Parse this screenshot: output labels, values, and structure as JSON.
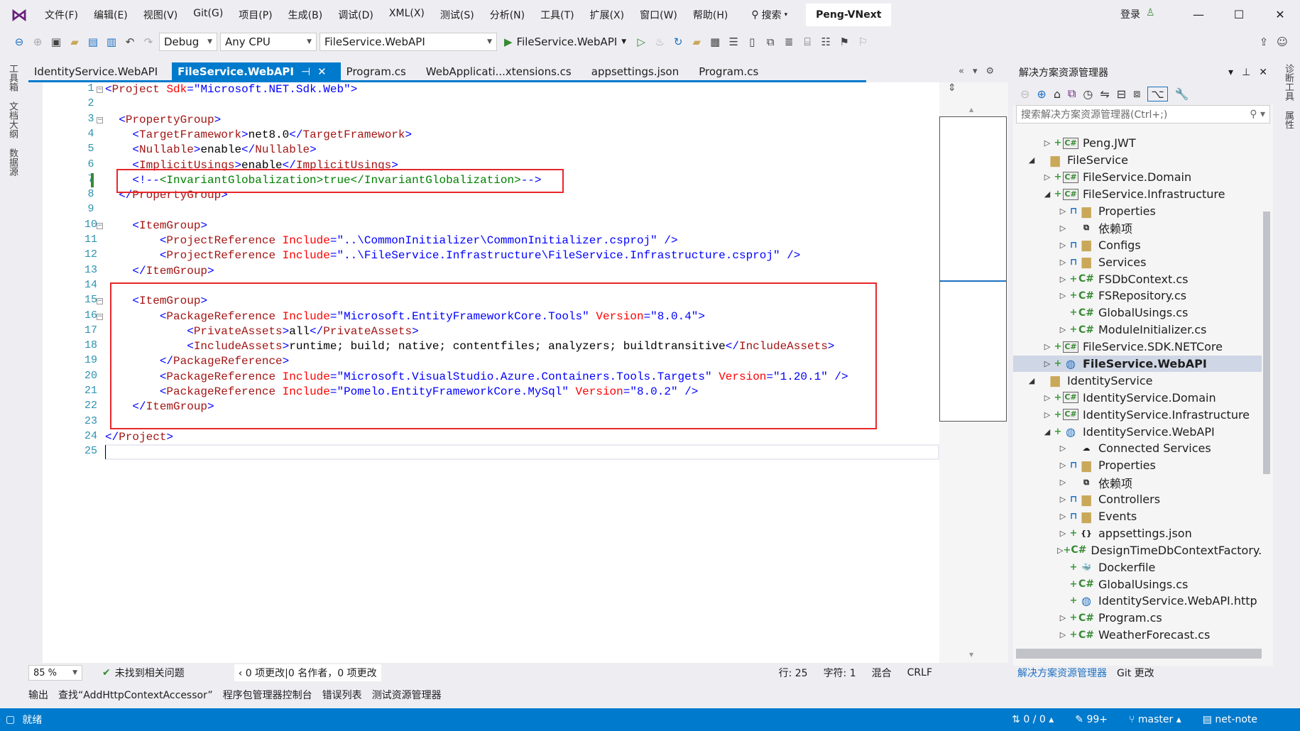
{
  "menu": [
    "文件(F)",
    "编辑(E)",
    "视图(V)",
    "Git(G)",
    "项目(P)",
    "生成(B)",
    "调试(D)",
    "XML(X)",
    "测试(S)",
    "分析(N)",
    "工具(T)",
    "扩展(X)",
    "窗口(W)",
    "帮助(H)"
  ],
  "search_label": "搜索",
  "solution_name": "Peng-VNext",
  "login_label": "登录",
  "toolbar": {
    "config": "Debug",
    "platform": "Any CPU",
    "startup_project": "FileService.WebAPI",
    "run_label": "FileService.WebAPI"
  },
  "left_strip": [
    "工具箱",
    "文档大纲",
    "数据源"
  ],
  "right_strip": [
    "诊断工具",
    "属性"
  ],
  "tabs": [
    "IdentityService.WebAPI",
    "FileService.WebAPI",
    "Program.cs",
    "WebApplicati...xtensions.cs",
    "appsettings.json",
    "Program.cs"
  ],
  "active_tab": 1,
  "editor": {
    "lines": [
      [
        [
          "b",
          "<"
        ],
        [
          "e",
          "Project"
        ],
        [
          "x",
          " "
        ],
        [
          "a",
          "Sdk"
        ],
        [
          "b",
          "=\""
        ],
        [
          "v",
          "Microsoft.NET.Sdk.Web"
        ],
        [
          "b",
          "\">"
        ]
      ],
      [],
      [
        [
          "x",
          "  "
        ],
        [
          "b",
          "<"
        ],
        [
          "e",
          "PropertyGroup"
        ],
        [
          "b",
          ">"
        ]
      ],
      [
        [
          "x",
          "    "
        ],
        [
          "b",
          "<"
        ],
        [
          "e",
          "TargetFramework"
        ],
        [
          "b",
          ">"
        ],
        [
          "x",
          "net8.0"
        ],
        [
          "b",
          "</"
        ],
        [
          "e",
          "TargetFramework"
        ],
        [
          "b",
          ">"
        ]
      ],
      [
        [
          "x",
          "    "
        ],
        [
          "b",
          "<"
        ],
        [
          "e",
          "Nullable"
        ],
        [
          "b",
          ">"
        ],
        [
          "x",
          "enable"
        ],
        [
          "b",
          "</"
        ],
        [
          "e",
          "Nullable"
        ],
        [
          "b",
          ">"
        ]
      ],
      [
        [
          "x",
          "    "
        ],
        [
          "b",
          "<"
        ],
        [
          "e",
          "ImplicitUsings"
        ],
        [
          "b",
          ">"
        ],
        [
          "x",
          "enable"
        ],
        [
          "b",
          "</"
        ],
        [
          "e",
          "ImplicitUsings"
        ],
        [
          "b",
          ">"
        ]
      ],
      [
        [
          "x",
          "    "
        ],
        [
          "b",
          "<!--"
        ],
        [
          "c",
          "<InvariantGlobalization>true</InvariantGlobalization>"
        ],
        [
          "b",
          "-->"
        ]
      ],
      [
        [
          "x",
          "  "
        ],
        [
          "b",
          "</"
        ],
        [
          "e",
          "PropertyGroup"
        ],
        [
          "b",
          ">"
        ]
      ],
      [],
      [
        [
          "x",
          "    "
        ],
        [
          "b",
          "<"
        ],
        [
          "e",
          "ItemGroup"
        ],
        [
          "b",
          ">"
        ]
      ],
      [
        [
          "x",
          "        "
        ],
        [
          "b",
          "<"
        ],
        [
          "e",
          "ProjectReference"
        ],
        [
          "x",
          " "
        ],
        [
          "a",
          "Include"
        ],
        [
          "b",
          "=\""
        ],
        [
          "v",
          "..\\CommonInitializer\\CommonInitializer.csproj"
        ],
        [
          "b",
          "\" />"
        ]
      ],
      [
        [
          "x",
          "        "
        ],
        [
          "b",
          "<"
        ],
        [
          "e",
          "ProjectReference"
        ],
        [
          "x",
          " "
        ],
        [
          "a",
          "Include"
        ],
        [
          "b",
          "=\""
        ],
        [
          "v",
          "..\\FileService.Infrastructure\\FileService.Infrastructure.csproj"
        ],
        [
          "b",
          "\" />"
        ]
      ],
      [
        [
          "x",
          "    "
        ],
        [
          "b",
          "</"
        ],
        [
          "e",
          "ItemGroup"
        ],
        [
          "b",
          ">"
        ]
      ],
      [],
      [
        [
          "x",
          "    "
        ],
        [
          "b",
          "<"
        ],
        [
          "e",
          "ItemGroup"
        ],
        [
          "b",
          ">"
        ]
      ],
      [
        [
          "x",
          "        "
        ],
        [
          "b",
          "<"
        ],
        [
          "e",
          "PackageReference"
        ],
        [
          "x",
          " "
        ],
        [
          "a",
          "Include"
        ],
        [
          "b",
          "=\""
        ],
        [
          "v",
          "Microsoft.EntityFrameworkCore.Tools"
        ],
        [
          "b",
          "\""
        ],
        [
          "x",
          " "
        ],
        [
          "a",
          "Version"
        ],
        [
          "b",
          "=\""
        ],
        [
          "v",
          "8.0.4"
        ],
        [
          "b",
          "\">"
        ]
      ],
      [
        [
          "x",
          "            "
        ],
        [
          "b",
          "<"
        ],
        [
          "e",
          "PrivateAssets"
        ],
        [
          "b",
          ">"
        ],
        [
          "x",
          "all"
        ],
        [
          "b",
          "</"
        ],
        [
          "e",
          "PrivateAssets"
        ],
        [
          "b",
          ">"
        ]
      ],
      [
        [
          "x",
          "            "
        ],
        [
          "b",
          "<"
        ],
        [
          "e",
          "IncludeAssets"
        ],
        [
          "b",
          ">"
        ],
        [
          "x",
          "runtime; build; native; contentfiles; analyzers; buildtransitive"
        ],
        [
          "b",
          "</"
        ],
        [
          "e",
          "IncludeAssets"
        ],
        [
          "b",
          ">"
        ]
      ],
      [
        [
          "x",
          "        "
        ],
        [
          "b",
          "</"
        ],
        [
          "e",
          "PackageReference"
        ],
        [
          "b",
          ">"
        ]
      ],
      [
        [
          "x",
          "        "
        ],
        [
          "b",
          "<"
        ],
        [
          "e",
          "PackageReference"
        ],
        [
          "x",
          " "
        ],
        [
          "a",
          "Include"
        ],
        [
          "b",
          "=\""
        ],
        [
          "v",
          "Microsoft.VisualStudio.Azure.Containers.Tools.Targets"
        ],
        [
          "b",
          "\""
        ],
        [
          "x",
          " "
        ],
        [
          "a",
          "Version"
        ],
        [
          "b",
          "=\""
        ],
        [
          "v",
          "1.20.1"
        ],
        [
          "b",
          "\" />"
        ]
      ],
      [
        [
          "x",
          "        "
        ],
        [
          "b",
          "<"
        ],
        [
          "e",
          "PackageReference"
        ],
        [
          "x",
          " "
        ],
        [
          "a",
          "Include"
        ],
        [
          "b",
          "=\""
        ],
        [
          "v",
          "Pomelo.EntityFrameworkCore.MySql"
        ],
        [
          "b",
          "\""
        ],
        [
          "x",
          " "
        ],
        [
          "a",
          "Version"
        ],
        [
          "b",
          "=\""
        ],
        [
          "v",
          "8.0.2"
        ],
        [
          "b",
          "\" />"
        ]
      ],
      [
        [
          "x",
          "    "
        ],
        [
          "b",
          "</"
        ],
        [
          "e",
          "ItemGroup"
        ],
        [
          "b",
          ">"
        ]
      ],
      [],
      [
        [
          "b",
          "</"
        ],
        [
          "e",
          "Project"
        ],
        [
          "b",
          ">"
        ]
      ],
      []
    ],
    "fold_lines": [
      1,
      3,
      10,
      15,
      16
    ],
    "current_line": 25
  },
  "solution_explorer": {
    "title": "解决方案资源管理器",
    "search_placeholder": "搜索解决方案资源管理器(Ctrl+;)",
    "items": [
      {
        "label": "Peng.JWT",
        "level": 1,
        "exp": "c",
        "git": "+",
        "icon": "proj"
      },
      {
        "label": "FileService",
        "level": 0,
        "exp": "e",
        "git": "",
        "icon": "folder"
      },
      {
        "label": "FileService.Domain",
        "level": 1,
        "exp": "c",
        "git": "+",
        "icon": "proj"
      },
      {
        "label": "FileService.Infrastructure",
        "level": 1,
        "exp": "e",
        "git": "+",
        "icon": "proj"
      },
      {
        "label": "Properties",
        "level": 2,
        "exp": "c",
        "git": "lock",
        "icon": "folder"
      },
      {
        "label": "依赖项",
        "level": 2,
        "exp": "c",
        "git": "",
        "icon": "deps"
      },
      {
        "label": "Configs",
        "level": 2,
        "exp": "c",
        "git": "lock",
        "icon": "folder"
      },
      {
        "label": "Services",
        "level": 2,
        "exp": "c",
        "git": "lock",
        "icon": "folder"
      },
      {
        "label": "FSDbContext.cs",
        "level": 2,
        "exp": "c",
        "git": "+",
        "icon": "cs"
      },
      {
        "label": "FSRepository.cs",
        "level": 2,
        "exp": "c",
        "git": "+",
        "icon": "cs"
      },
      {
        "label": "GlobalUsings.cs",
        "level": 2,
        "exp": "",
        "git": "+",
        "icon": "cs"
      },
      {
        "label": "ModuleInitializer.cs",
        "level": 2,
        "exp": "c",
        "git": "+",
        "icon": "cs"
      },
      {
        "label": "FileService.SDK.NETCore",
        "level": 1,
        "exp": "c",
        "git": "+",
        "icon": "proj"
      },
      {
        "label": "FileService.WebAPI",
        "level": 1,
        "exp": "c",
        "git": "+",
        "icon": "web",
        "selected": true
      },
      {
        "label": "IdentityService",
        "level": 0,
        "exp": "e",
        "git": "",
        "icon": "folder"
      },
      {
        "label": "IdentityService.Domain",
        "level": 1,
        "exp": "c",
        "git": "+",
        "icon": "proj"
      },
      {
        "label": "IdentityService.Infrastructure",
        "level": 1,
        "exp": "c",
        "git": "+",
        "icon": "proj"
      },
      {
        "label": "IdentityService.WebAPI",
        "level": 1,
        "exp": "e",
        "git": "+",
        "icon": "web"
      },
      {
        "label": "Connected Services",
        "level": 2,
        "exp": "c",
        "git": "",
        "icon": "cloud"
      },
      {
        "label": "Properties",
        "level": 2,
        "exp": "c",
        "git": "lock",
        "icon": "folder"
      },
      {
        "label": "依赖项",
        "level": 2,
        "exp": "c",
        "git": "",
        "icon": "deps"
      },
      {
        "label": "Controllers",
        "level": 2,
        "exp": "c",
        "git": "lock",
        "icon": "folder"
      },
      {
        "label": "Events",
        "level": 2,
        "exp": "c",
        "git": "lock",
        "icon": "folder"
      },
      {
        "label": "appsettings.json",
        "level": 2,
        "exp": "c",
        "git": "+",
        "icon": "json"
      },
      {
        "label": "DesignTimeDbContextFactory.cs",
        "level": 2,
        "exp": "c",
        "git": "+",
        "icon": "cs"
      },
      {
        "label": "Dockerfile",
        "level": 2,
        "exp": "",
        "git": "+",
        "icon": "docker"
      },
      {
        "label": "GlobalUsings.cs",
        "level": 2,
        "exp": "",
        "git": "+",
        "icon": "cs"
      },
      {
        "label": "IdentityService.WebAPI.http",
        "level": 2,
        "exp": "",
        "git": "+",
        "icon": "web"
      },
      {
        "label": "Program.cs",
        "level": 2,
        "exp": "c",
        "git": "+",
        "icon": "cs"
      },
      {
        "label": "WeatherForecast.cs",
        "level": 2,
        "exp": "c",
        "git": "+",
        "icon": "cs"
      }
    ],
    "bottom_tabs": [
      "解决方案资源管理器",
      "Git 更改"
    ]
  },
  "editor_status": {
    "zoom": "85 %",
    "issues": "未找到相关问题",
    "changes": "0 项更改|0 名作者，0 项更改",
    "line": "行: 25",
    "char": "字符: 1",
    "mixed": "混合",
    "eol": "CRLF"
  },
  "bottom_tabs": [
    "输出",
    "查找“AddHttpContextAccessor”",
    "程序包管理器控制台",
    "错误列表",
    "测试资源管理器"
  ],
  "statusbar": {
    "ready": "就绪",
    "sync": "0 / 0",
    "pending": "99+",
    "branch": "master",
    "repo": "net-note"
  }
}
